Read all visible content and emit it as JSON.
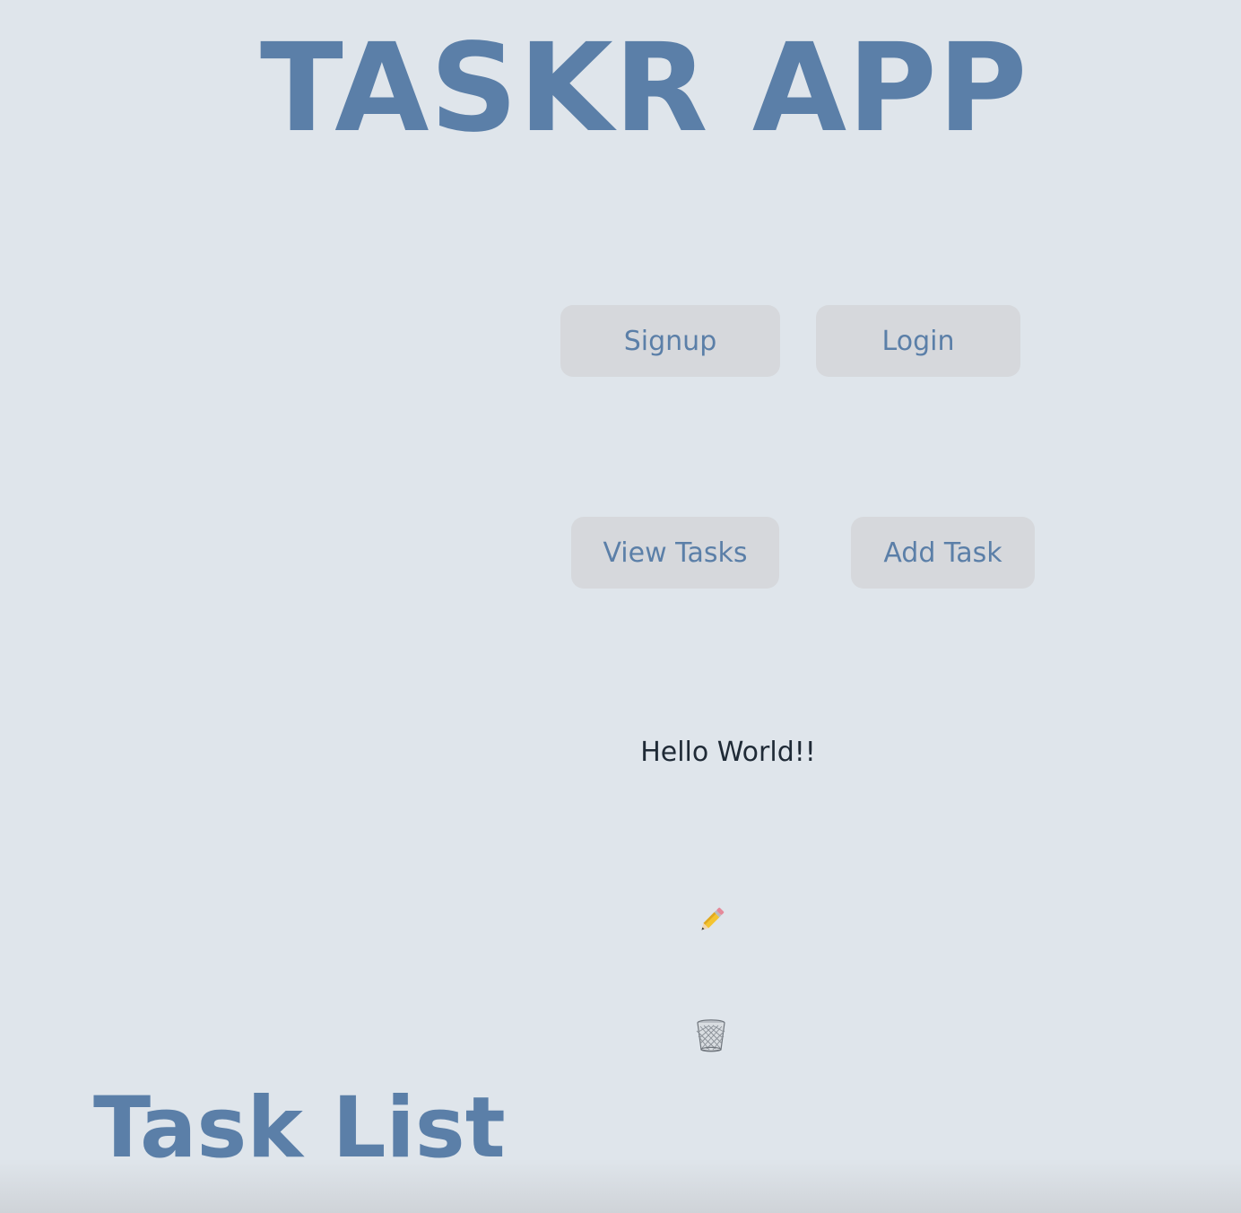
{
  "app": {
    "title": "TASKR APP"
  },
  "auth": {
    "signup_label": "Signup",
    "login_label": "Login"
  },
  "tasks_nav": {
    "view_label": "View Tasks",
    "add_label": "Add Task"
  },
  "task": {
    "text": "Hello World!!",
    "edit_icon": "pencil-icon",
    "delete_icon": "trash-icon"
  },
  "section": {
    "title": "Task List"
  },
  "colors": {
    "background": "#dfe5eb",
    "accent": "#5b7fa8",
    "button_bg": "#d6d8dc",
    "text": "#1f2a36"
  }
}
